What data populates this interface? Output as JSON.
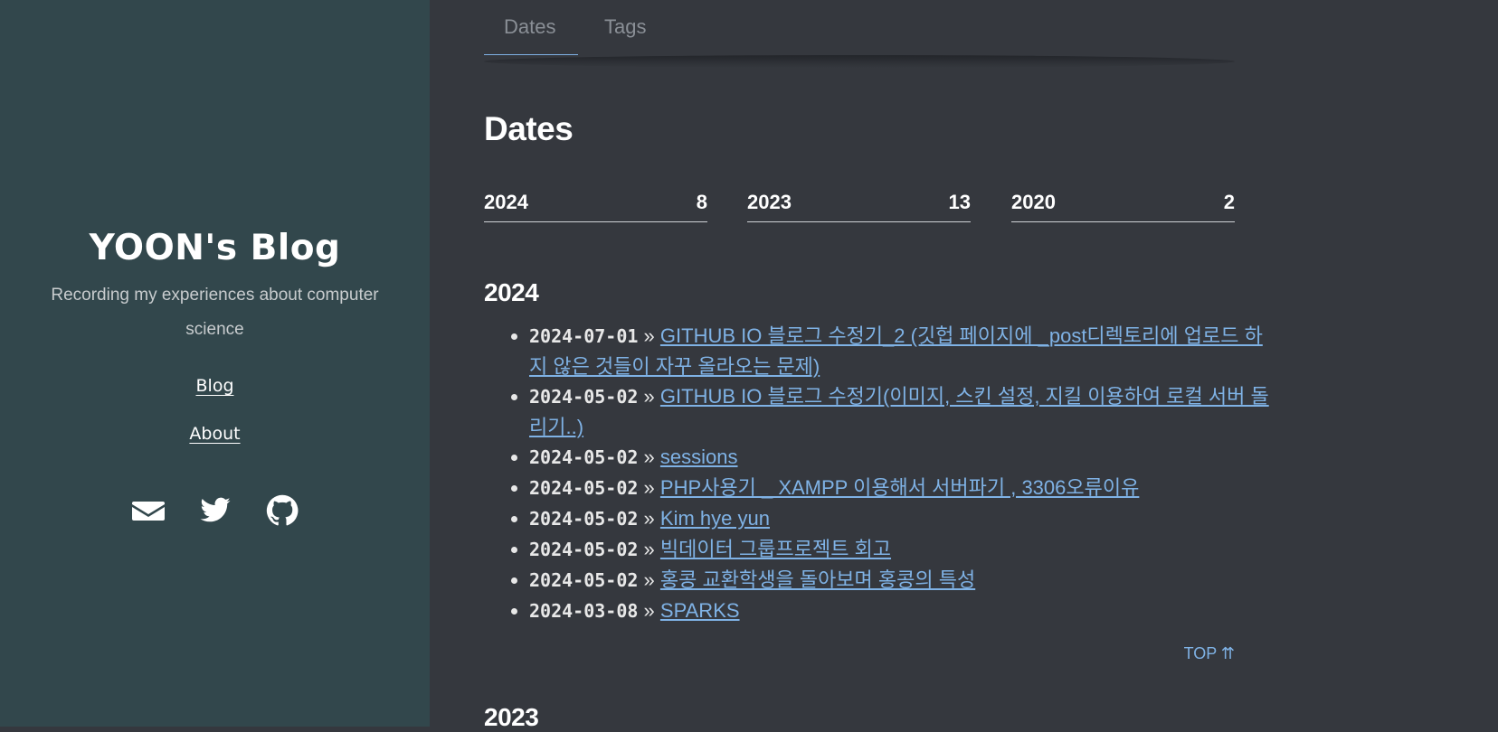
{
  "sidebar": {
    "title": "YOON's Blog",
    "description": "Recording my experiences about computer science",
    "nav": [
      {
        "label": "Blog"
      },
      {
        "label": "About"
      }
    ],
    "social": [
      "envelope-icon",
      "twitter-icon",
      "github-icon"
    ]
  },
  "tabs": [
    {
      "label": "Dates"
    },
    {
      "label": "Tags"
    }
  ],
  "main": {
    "page_title": "Dates",
    "years": [
      {
        "year": "2024",
        "count": "8"
      },
      {
        "year": "2023",
        "count": "13"
      },
      {
        "year": "2020",
        "count": "2"
      }
    ],
    "section_2024": {
      "title": "2024",
      "posts": [
        {
          "date": "2024-07-01",
          "title": "GITHUB IO 블로그 수정기_2 (깃헙 페이지에 _post디렉토리에 업로드 하지 않은 것들이 자꾸 올라오는 문제)"
        },
        {
          "date": "2024-05-02",
          "title": "GITHUB IO 블로그 수정기(이미지, 스킨 설정, 지킬 이용하여 로컬 서버 돌리기..)"
        },
        {
          "date": "2024-05-02",
          "title": "sessions"
        },
        {
          "date": "2024-05-02",
          "title": "PHP사용기 _ XAMPP 이용해서 서버파기 , 3306오류이유"
        },
        {
          "date": "2024-05-02",
          "title": "Kim hye yun"
        },
        {
          "date": "2024-05-02",
          "title": "빅데이터 그룹프로젝트 회고"
        },
        {
          "date": "2024-05-02",
          "title": "홍콩 교환학생을 돌아보며 홍콩의 특성"
        },
        {
          "date": "2024-03-08",
          "title": "SPARKS"
        }
      ]
    },
    "top_link": "TOP ⇈",
    "next_section_title": "2023"
  },
  "colors": {
    "sidebar_bg": "#32474c",
    "main_bg": "#35383e",
    "link": "#7fb2e5"
  }
}
